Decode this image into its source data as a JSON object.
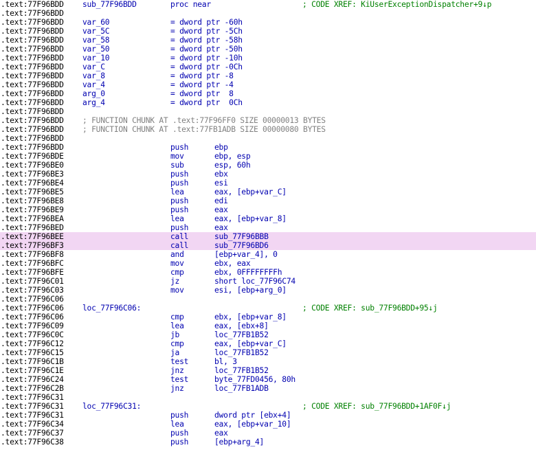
{
  "rows": [
    {
      "addr": ".text:77F96BDD",
      "name": "sub_77F96BDD",
      "mnem": "proc near",
      "xref": "; CODE XREF: KiUserExceptionDispatcher+9↓p"
    },
    {
      "addr": ".text:77F96BDD"
    },
    {
      "addr": ".text:77F96BDD",
      "name": "var_60",
      "mnem": "= dword ptr -60h"
    },
    {
      "addr": ".text:77F96BDD",
      "name": "var_5C",
      "mnem": "= dword ptr -5Ch"
    },
    {
      "addr": ".text:77F96BDD",
      "name": "var_58",
      "mnem": "= dword ptr -58h"
    },
    {
      "addr": ".text:77F96BDD",
      "name": "var_50",
      "mnem": "= dword ptr -50h"
    },
    {
      "addr": ".text:77F96BDD",
      "name": "var_10",
      "mnem": "= dword ptr -10h"
    },
    {
      "addr": ".text:77F96BDD",
      "name": "var_C",
      "mnem": "= dword ptr -0Ch"
    },
    {
      "addr": ".text:77F96BDD",
      "name": "var_8",
      "mnem": "= dword ptr -8"
    },
    {
      "addr": ".text:77F96BDD",
      "name": "var_4",
      "mnem": "= dword ptr -4"
    },
    {
      "addr": ".text:77F96BDD",
      "name": "arg_0",
      "mnem": "= dword ptr  8"
    },
    {
      "addr": ".text:77F96BDD",
      "name": "arg_4",
      "mnem": "= dword ptr  0Ch"
    },
    {
      "addr": ".text:77F96BDD"
    },
    {
      "addr": ".text:77F96BDD",
      "cmt": "; FUNCTION CHUNK AT .text:77F96FF0 SIZE 00000013 BYTES"
    },
    {
      "addr": ".text:77F96BDD",
      "cmt": "; FUNCTION CHUNK AT .text:77FB1ADB SIZE 00000080 BYTES"
    },
    {
      "addr": ".text:77F96BDD"
    },
    {
      "addr": ".text:77F96BDD",
      "mnem": "push",
      "ops": "ebp"
    },
    {
      "addr": ".text:77F96BDE",
      "mnem": "mov",
      "ops": "ebp, esp"
    },
    {
      "addr": ".text:77F96BE0",
      "mnem": "sub",
      "ops": "esp, 60h"
    },
    {
      "addr": ".text:77F96BE3",
      "mnem": "push",
      "ops": "ebx"
    },
    {
      "addr": ".text:77F96BE4",
      "mnem": "push",
      "ops": "esi"
    },
    {
      "addr": ".text:77F96BE5",
      "mnem": "lea",
      "ops": "eax, [ebp+var_C]"
    },
    {
      "addr": ".text:77F96BE8",
      "mnem": "push",
      "ops": "edi"
    },
    {
      "addr": ".text:77F96BE9",
      "mnem": "push",
      "ops": "eax"
    },
    {
      "addr": ".text:77F96BEA",
      "mnem": "lea",
      "ops": "eax, [ebp+var_8]"
    },
    {
      "addr": ".text:77F96BED",
      "mnem": "push",
      "ops": "eax"
    },
    {
      "addr": ".text:77F96BEE",
      "mnem": "call",
      "ops": "sub_77F96BBB",
      "hl": true
    },
    {
      "addr": ".text:77F96BF3",
      "mnem": "call",
      "ops": "sub_77F96BD6",
      "hl": true
    },
    {
      "addr": ".text:77F96BF8",
      "mnem": "and",
      "ops": "[ebp+var_4], 0"
    },
    {
      "addr": ".text:77F96BFC",
      "mnem": "mov",
      "ops": "ebx, eax"
    },
    {
      "addr": ".text:77F96BFE",
      "mnem": "cmp",
      "ops": "ebx, 0FFFFFFFFh"
    },
    {
      "addr": ".text:77F96C01",
      "mnem": "jz",
      "ops": "short loc_77F96C74"
    },
    {
      "addr": ".text:77F96C03",
      "mnem": "mov",
      "ops": "esi, [ebp+arg_0]"
    },
    {
      "addr": ".text:77F96C06"
    },
    {
      "addr": ".text:77F96C06",
      "name": "loc_77F96C06:",
      "xref": "; CODE XREF: sub_77F96BDD+95↓j"
    },
    {
      "addr": ".text:77F96C06",
      "mnem": "cmp",
      "ops": "ebx, [ebp+var_8]"
    },
    {
      "addr": ".text:77F96C09",
      "mnem": "lea",
      "ops": "eax, [ebx+8]"
    },
    {
      "addr": ".text:77F96C0C",
      "mnem": "jb",
      "ops": "loc_77FB1B52"
    },
    {
      "addr": ".text:77F96C12",
      "mnem": "cmp",
      "ops": "eax, [ebp+var_C]"
    },
    {
      "addr": ".text:77F96C15",
      "mnem": "ja",
      "ops": "loc_77FB1B52"
    },
    {
      "addr": ".text:77F96C1B",
      "mnem": "test",
      "ops": "bl, 3"
    },
    {
      "addr": ".text:77F96C1E",
      "mnem": "jnz",
      "ops": "loc_77FB1B52"
    },
    {
      "addr": ".text:77F96C24",
      "mnem": "test",
      "ops": "byte_77FD0456, 80h"
    },
    {
      "addr": ".text:77F96C2B",
      "mnem": "jnz",
      "ops": "loc_77FB1ADB"
    },
    {
      "addr": ".text:77F96C31"
    },
    {
      "addr": ".text:77F96C31",
      "name": "loc_77F96C31:",
      "xref": "; CODE XREF: sub_77F96BDD+1AF0F↓j"
    },
    {
      "addr": ".text:77F96C31",
      "mnem": "push",
      "ops": "dword ptr [ebx+4]"
    },
    {
      "addr": ".text:77F96C34",
      "mnem": "lea",
      "ops": "eax, [ebp+var_10]"
    },
    {
      "addr": ".text:77F96C37",
      "mnem": "push",
      "ops": "eax"
    },
    {
      "addr": ".text:77F96C38",
      "mnem": "push",
      "ops": "[ebp+arg_4]"
    }
  ]
}
